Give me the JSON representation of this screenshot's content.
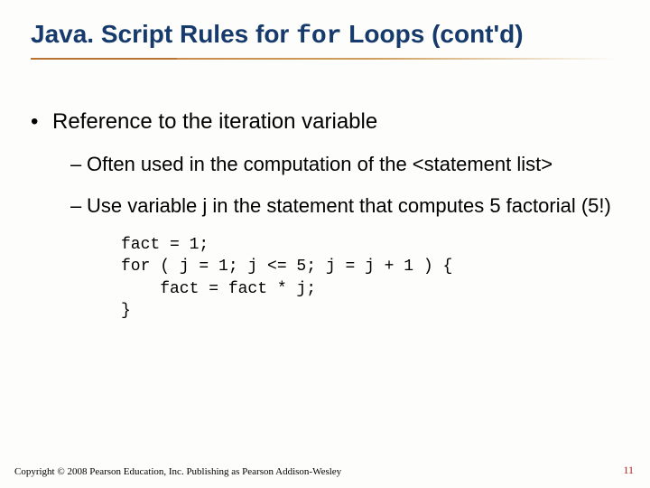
{
  "title": {
    "pre": "Java. Script Rules for ",
    "code": "for",
    "post": " Loops (cont'd)"
  },
  "bullets": {
    "l1": "Reference to the iteration variable",
    "l2a": "Often used in the computation of the <statement list>",
    "l2b": "Use variable j in the statement that computes 5 factorial (5!)"
  },
  "code": "fact = 1;\nfor ( j = 1; j <= 5; j = j + 1 ) {\n    fact = fact * j;\n}",
  "footer": "Copyright © 2008 Pearson Education, Inc. Publishing as Pearson Addison-Wesley",
  "page": "11"
}
